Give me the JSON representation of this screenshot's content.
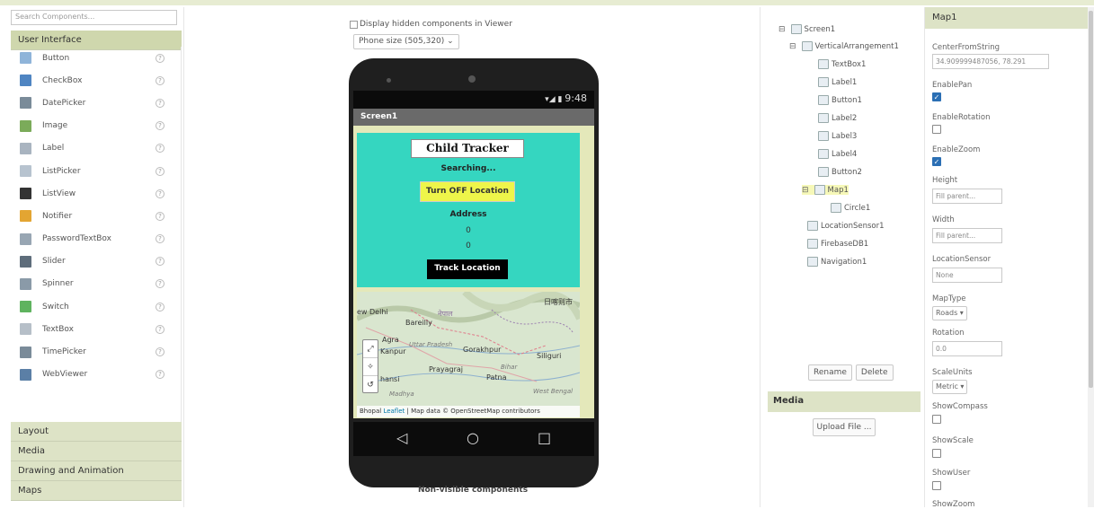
{
  "palette": {
    "search_placeholder": "Search Components...",
    "active_category": "User Interface",
    "components": [
      {
        "label": "Button",
        "icon": "button-icon",
        "color": "#8fb4d9"
      },
      {
        "label": "CheckBox",
        "icon": "checkbox-icon",
        "color": "#4f85c2"
      },
      {
        "label": "DatePicker",
        "icon": "datepicker-icon",
        "color": "#7a8b99"
      },
      {
        "label": "Image",
        "icon": "image-icon",
        "color": "#7bab5a"
      },
      {
        "label": "Label",
        "icon": "label-icon",
        "color": "#a9b4c0"
      },
      {
        "label": "ListPicker",
        "icon": "listpicker-icon",
        "color": "#b7c3cf"
      },
      {
        "label": "ListView",
        "icon": "listview-icon",
        "color": "#333333"
      },
      {
        "label": "Notifier",
        "icon": "notifier-icon",
        "color": "#e3a532"
      },
      {
        "label": "PasswordTextBox",
        "icon": "password-icon",
        "color": "#98a6b3"
      },
      {
        "label": "Slider",
        "icon": "slider-icon",
        "color": "#5e6d7b"
      },
      {
        "label": "Spinner",
        "icon": "spinner-icon",
        "color": "#8a9aa8"
      },
      {
        "label": "Switch",
        "icon": "switch-icon",
        "color": "#5fb35f"
      },
      {
        "label": "TextBox",
        "icon": "textbox-icon",
        "color": "#b6bfc8"
      },
      {
        "label": "TimePicker",
        "icon": "timepicker-icon",
        "color": "#7a8b99"
      },
      {
        "label": "WebViewer",
        "icon": "webviewer-icon",
        "color": "#5b7fa6"
      }
    ],
    "help_glyph": "?",
    "categories": [
      "Layout",
      "Media",
      "Drawing and Animation",
      "Maps"
    ]
  },
  "viewer": {
    "hidden_checkbox_label": "Display hidden components in Viewer",
    "phone_size": "Phone size (505,320)",
    "status_time": "9:48",
    "screen_title": "Screen1",
    "app_title": "Child Tracker",
    "searching": "Searching...",
    "turn_off_button": "Turn OFF Location",
    "address_label": "Address",
    "coord_1": "0",
    "coord_2": "0",
    "track_button": "Track Location",
    "map_places": {
      "new_delhi": "ew Delhi",
      "bareilly": "Bareilly",
      "agra": "Agra",
      "uttar_pradesh": "Uttar Pradesh",
      "kanpur": "Kanpur",
      "gorakhpur": "Gorakhpur",
      "siliguri": "Siliguri",
      "prayagraj": "Prayagraj",
      "patna": "Patna",
      "bihar": "Bihar",
      "west_bengal": "West Bengal",
      "jhansi": "hansi",
      "bhopal": "Bhopal",
      "madhya": "Madhya",
      "nepal": "नेपाल",
      "nepal_right": "日喀则市"
    },
    "attribution_leaflet": "Leaflet",
    "attribution_rest": " | Map data © OpenStreetMap contributors",
    "nav_back": "◁",
    "nav_home": "○",
    "nav_recent": "□",
    "non_visible": "Non-visible components"
  },
  "tree": {
    "nodes": [
      {
        "label": "Screen1",
        "toggle": "⊟"
      },
      {
        "label": "VerticalArrangement1",
        "toggle": "⊟"
      },
      {
        "label": "TextBox1"
      },
      {
        "label": "Label1"
      },
      {
        "label": "Button1"
      },
      {
        "label": "Label2"
      },
      {
        "label": "Label3"
      },
      {
        "label": "Label4"
      },
      {
        "label": "Button2"
      },
      {
        "label": "Map1",
        "toggle": "⊟"
      },
      {
        "label": "Circle1"
      },
      {
        "label": "LocationSensor1"
      },
      {
        "label": "FirebaseDB1"
      },
      {
        "label": "Navigation1"
      }
    ],
    "rename_button": "Rename",
    "delete_button": "Delete",
    "media_header": "Media",
    "upload_button": "Upload File ..."
  },
  "properties": {
    "component": "Map1",
    "center_label": "CenterFromString",
    "center_value": "34.909999487056, 78.291",
    "enable_pan_label": "EnablePan",
    "enable_pan": true,
    "enable_rotation_label": "EnableRotation",
    "enable_rotation": false,
    "enable_zoom_label": "EnableZoom",
    "enable_zoom": true,
    "height_label": "Height",
    "height_value": "Fill parent...",
    "width_label": "Width",
    "width_value": "Fill parent...",
    "location_sensor_label": "LocationSensor",
    "location_sensor_value": "None",
    "map_type_label": "MapType",
    "map_type_value": "Roads",
    "rotation_label": "Rotation",
    "rotation_value": "0.0",
    "scale_units_label": "ScaleUnits",
    "scale_units_value": "Metric",
    "show_compass_label": "ShowCompass",
    "show_scale_label": "ShowScale",
    "show_user_label": "ShowUser",
    "show_zoom_label": "ShowZoom"
  },
  "colors": {
    "app_background": "#35d6c0",
    "turn_off_button": "#eef54a",
    "track_button": "#000000",
    "panel_header": "#dde3c6"
  }
}
